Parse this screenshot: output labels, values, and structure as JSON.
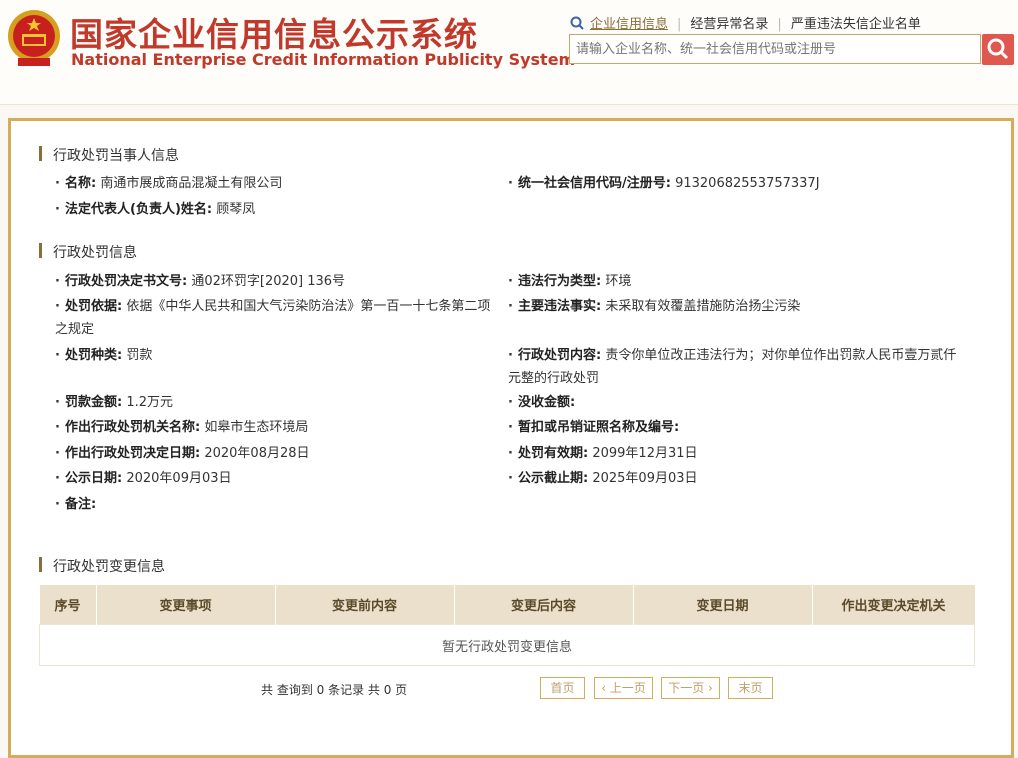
{
  "header": {
    "title_cn": "国家企业信用信息公示系统",
    "title_en": "National Enterprise Credit Information Publicity System",
    "links": [
      "企业信用信息",
      "经营异常名录",
      "严重违法失信企业名单"
    ],
    "search_placeholder": "请输入企业名称、统一社会信用代码或注册号"
  },
  "party_section": {
    "title": "行政处罚当事人信息",
    "name_label": "名称:",
    "name_value": "南通市展成商品混凝土有限公司",
    "code_label": "统一社会信用代码/注册号:",
    "code_value": "91320682553757337J",
    "rep_label": "法定代表人(负责人)姓名:",
    "rep_value": "顾琴凤"
  },
  "penalty_section": {
    "title": "行政处罚信息",
    "doc_label": "行政处罚决定书文号:",
    "doc_value": "通02环罚字[2020] 136号",
    "type_label": "违法行为类型:",
    "type_value": "环境",
    "basis_label": "处罚依据:",
    "basis_value": "依据《中华人民共和国大气污染防治法》第一百一十七条第二项之规定",
    "facts_label": "主要违法事实:",
    "facts_value": "未采取有效覆盖措施防治扬尘污染",
    "kind_label": "处罚种类:",
    "kind_value": "罚款",
    "content_label": "行政处罚内容:",
    "content_value": "责令你单位改正违法行为；对你单位作出罚款人民币壹万贰仟元整的行政处罚",
    "amount_label": "罚款金额:",
    "amount_value": "1.2万元",
    "confiscate_label": "没收金额:",
    "confiscate_value": "",
    "org_label": "作出行政处罚机关名称:",
    "org_value": "如皋市生态环境局",
    "license_label": "暂扣或吊销证照名称及编号:",
    "license_value": "",
    "date_label": "作出行政处罚决定日期:",
    "date_value": "2020年08月28日",
    "valid_label": "处罚有效期:",
    "valid_value": "2099年12月31日",
    "pubdate_label": "公示日期:",
    "pubdate_value": "2020年09月03日",
    "pubend_label": "公示截止期:",
    "pubend_value": "2025年09月03日",
    "remark_label": "备注:",
    "remark_value": ""
  },
  "change_section": {
    "title": "行政处罚变更信息",
    "columns": [
      "序号",
      "变更事项",
      "变更前内容",
      "变更后内容",
      "变更日期",
      "作出变更决定机关"
    ],
    "empty_text": "暂无行政处罚变更信息",
    "summary": "共 查询到 0 条记录 共 0 页",
    "pager": [
      "首页",
      "‹ 上一页",
      "下一页 ›",
      "末页"
    ]
  }
}
